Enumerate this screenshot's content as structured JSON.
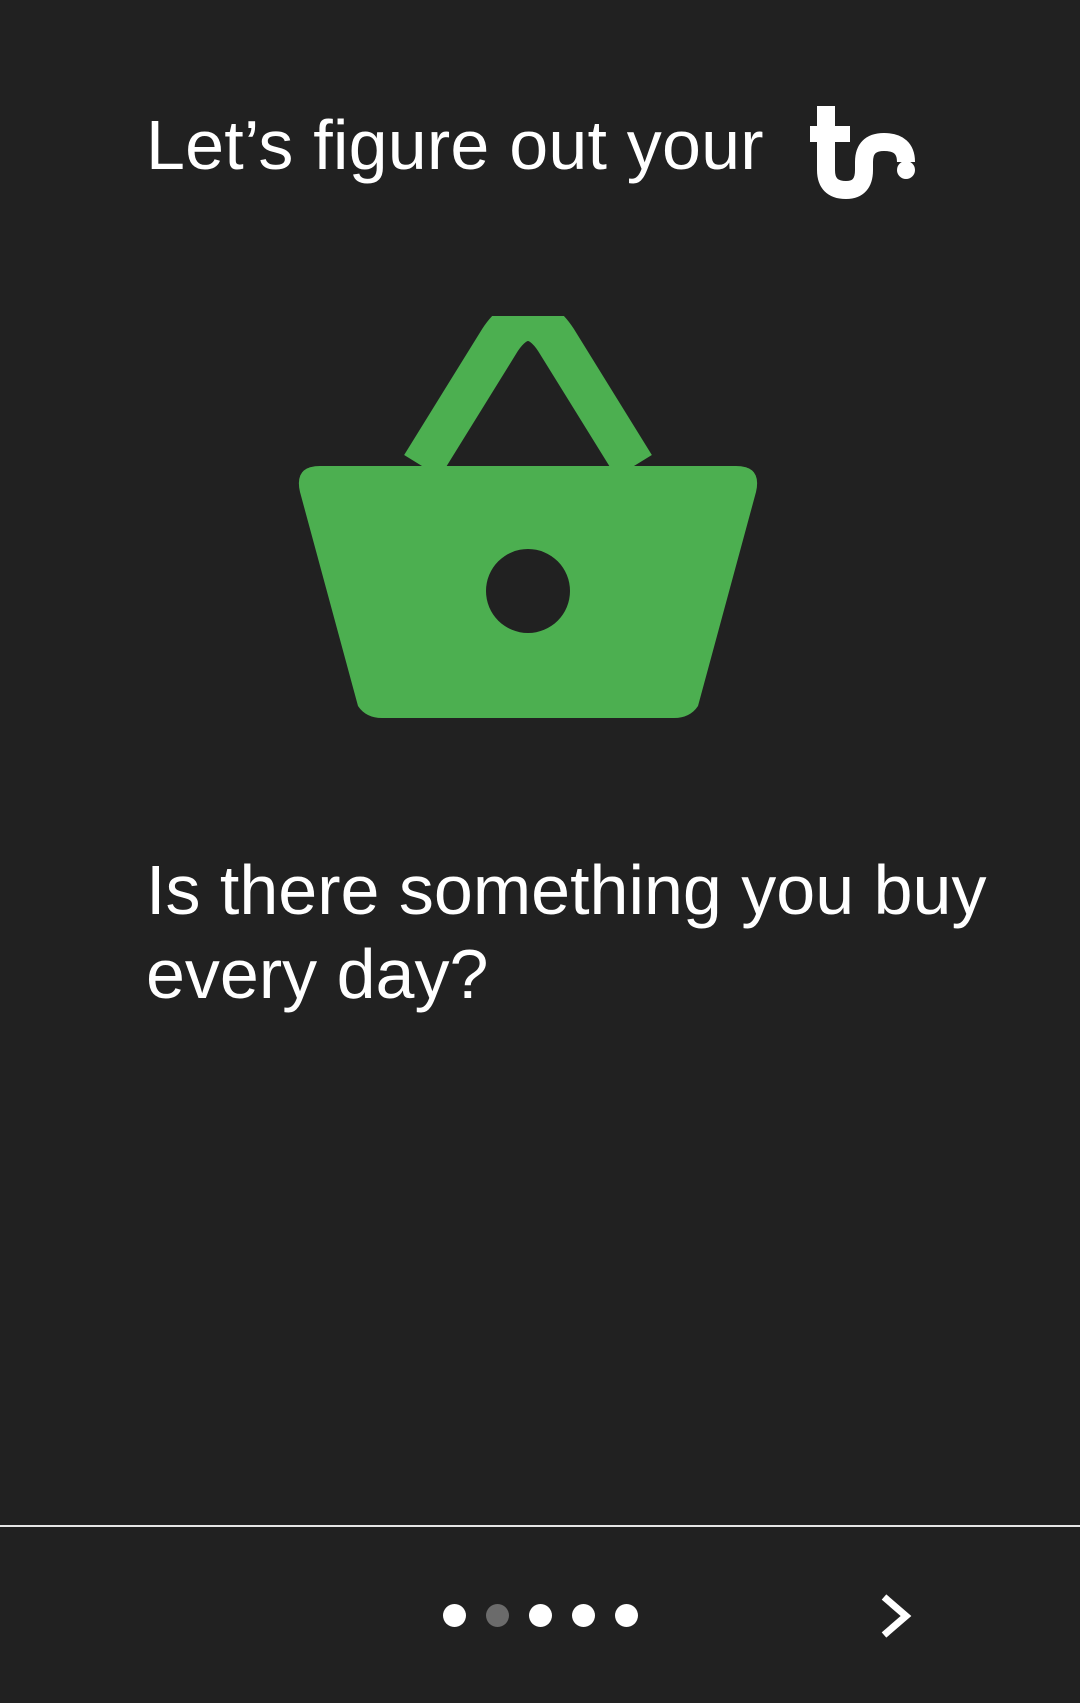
{
  "header": {
    "title": "Let’s figure out your",
    "logo_icon": "tc-logo-icon"
  },
  "illustration": {
    "icon": "shopping-basket-icon",
    "color": "#4CAF50"
  },
  "question": {
    "text": "Is there something you buy every day?"
  },
  "footer": {
    "pager": {
      "total": 5,
      "active_index": 1
    },
    "next_icon": "chevron-right-icon"
  },
  "colors": {
    "background": "#212121",
    "text": "#FFFFFF",
    "accent": "#4CAF50",
    "dot_inactive": "#FFFFFF",
    "dot_active": "#6B6B6B"
  }
}
